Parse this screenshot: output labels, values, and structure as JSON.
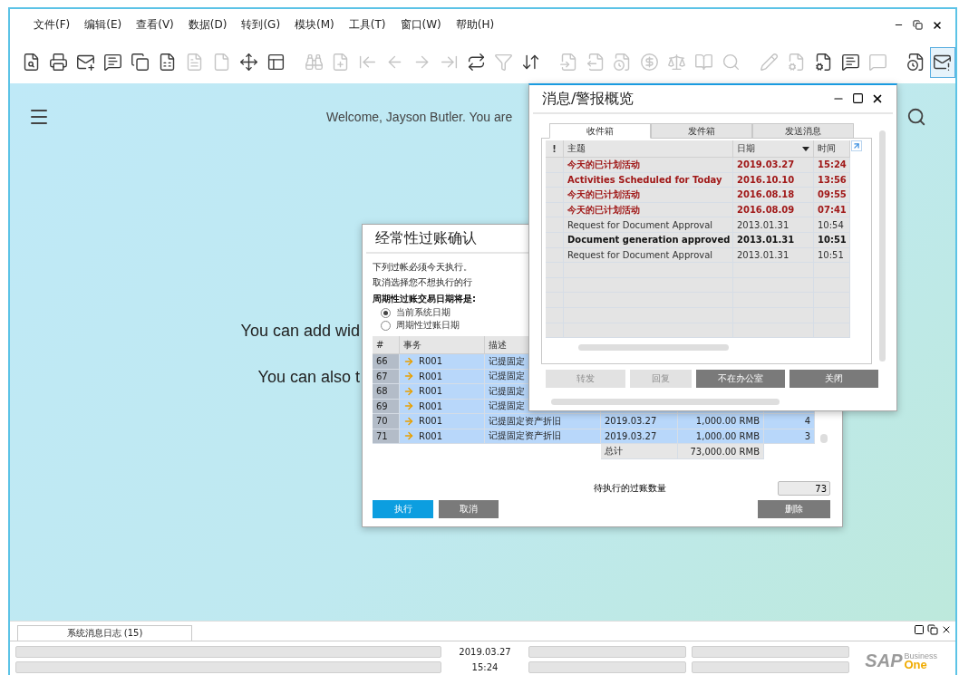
{
  "menu": [
    "文件(F)",
    "编辑(E)",
    "查看(V)",
    "数据(D)",
    "转到(G)",
    "模块(M)",
    "工具(T)",
    "窗口(W)",
    "帮助(H)"
  ],
  "toolbar": [
    {
      "disabled": false,
      "selected": false
    },
    {
      "disabled": false,
      "selected": false
    },
    {
      "disabled": false,
      "selected": false
    },
    {
      "disabled": false,
      "selected": false
    },
    {
      "disabled": false,
      "selected": false
    },
    {
      "disabled": false,
      "selected": false
    },
    {
      "disabled": true,
      "selected": false
    },
    {
      "disabled": true,
      "selected": false
    },
    {
      "disabled": false,
      "selected": false
    },
    {
      "disabled": false,
      "selected": false
    },
    {
      "disabled": true,
      "selected": false
    },
    {
      "disabled": true,
      "selected": false
    },
    {
      "disabled": true,
      "selected": false
    },
    {
      "disabled": true,
      "selected": false
    },
    {
      "disabled": true,
      "selected": false
    },
    {
      "disabled": true,
      "selected": false
    },
    {
      "disabled": false,
      "selected": false
    },
    {
      "disabled": true,
      "selected": false
    },
    {
      "disabled": false,
      "selected": false
    },
    {
      "disabled": true,
      "selected": false
    },
    {
      "disabled": true,
      "selected": false
    },
    {
      "disabled": true,
      "selected": false
    },
    {
      "disabled": true,
      "selected": false
    },
    {
      "disabled": true,
      "selected": false
    },
    {
      "disabled": true,
      "selected": false
    },
    {
      "disabled": true,
      "selected": false
    },
    {
      "disabled": true,
      "selected": false
    },
    {
      "disabled": true,
      "selected": false
    },
    {
      "disabled": false,
      "selected": false
    },
    {
      "disabled": false,
      "selected": false
    },
    {
      "disabled": true,
      "selected": false
    },
    {
      "disabled": false,
      "selected": false
    },
    {
      "disabled": false,
      "selected": true
    }
  ],
  "desktop": {
    "welcome": "Welcome, Jayson Butler. You are",
    "lines": [
      "You can add wid",
      "You can also t"
    ]
  },
  "recurring_postings": {
    "title": "经常性过账确认",
    "notes": [
      "下列过帐必须今天执行。",
      "取消选择您不想执行的行"
    ],
    "date_prompt": "周期性过账交易日期将是:",
    "date_options": [
      {
        "label": "当前系统日期",
        "selected": true
      },
      {
        "label": "周期性过账日期",
        "selected": false
      }
    ],
    "columns": [
      "#",
      "事务",
      "描述"
    ],
    "rows": [
      {
        "number": "66",
        "transaction": "R001",
        "description": "记提固定"
      },
      {
        "number": "67",
        "transaction": "R001",
        "description": "记提固定"
      },
      {
        "number": "68",
        "transaction": "R001",
        "description": "记提固定"
      },
      {
        "number": "69",
        "transaction": "R001",
        "description": "记提固定"
      },
      {
        "number": "70",
        "transaction": "R001",
        "description": "记提固定资产折旧",
        "date": "2019.03.27",
        "amount": "1,000.00 RMB",
        "count": "4"
      },
      {
        "number": "71",
        "transaction": "R001",
        "description": "记提固定资产折旧",
        "date": "2019.03.27",
        "amount": "1,000.00 RMB",
        "count": "3"
      }
    ],
    "total": {
      "label": "总计",
      "amount": "73,000.00 RMB"
    },
    "pending_label": "待执行的过账数量",
    "pending_count": "73",
    "buttons": [
      {
        "label": "执行",
        "kind": "primary"
      },
      {
        "label": "取消",
        "kind": "secondary"
      },
      {
        "label": "删除",
        "kind": "secondary"
      }
    ]
  },
  "messages_window": {
    "title": "消息/警报概览",
    "tabs": [
      {
        "label": "收件箱",
        "selected": true
      },
      {
        "label": "发件箱",
        "selected": false
      },
      {
        "label": "发送消息",
        "selected": false
      }
    ],
    "columns": [
      "!",
      "主题",
      "日期",
      "时间"
    ],
    "rows": [
      {
        "subject": "今天的已计划活动",
        "date": "2019.03.27",
        "time": "15:24",
        "kind": "alert"
      },
      {
        "subject": "Activities Scheduled for Today",
        "date": "2016.10.10",
        "time": "13:56",
        "kind": "alert"
      },
      {
        "subject": "今天的已计划活动",
        "date": "2016.08.18",
        "time": "09:55",
        "kind": "alert"
      },
      {
        "subject": "今天的已计划活动",
        "date": "2016.08.09",
        "time": "07:41",
        "kind": "alert"
      },
      {
        "subject": "Request for Document Approval",
        "date": "2013.01.31",
        "time": "10:54",
        "kind": "read"
      },
      {
        "subject": "Document generation approved",
        "date": "2013.01.31",
        "time": "10:51",
        "kind": "unread"
      },
      {
        "subject": "Request for Document Approval",
        "date": "2013.01.31",
        "time": "10:51",
        "kind": "read"
      }
    ],
    "buttons": [
      {
        "label": "转发",
        "disabled": true
      },
      {
        "label": "回复",
        "disabled": true
      },
      {
        "label": "不在办公室",
        "disabled": false
      },
      {
        "label": "关闭",
        "disabled": false
      }
    ]
  },
  "status_bar": {
    "log_tab": "系统消息日志 (15)",
    "date": "2019.03.27",
    "time": "15:24"
  },
  "logo": {
    "brand": "SAP",
    "line1": "Business",
    "line2": "One"
  }
}
